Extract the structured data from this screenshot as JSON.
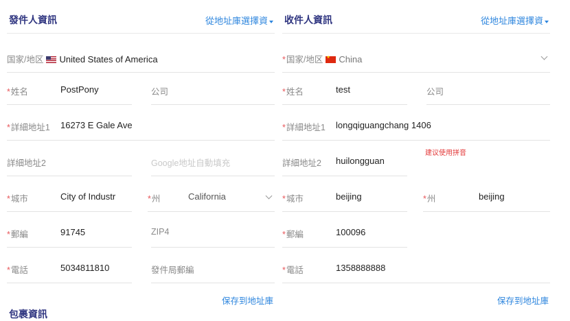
{
  "sender": {
    "title": "發件人資訊",
    "address_book_select": "從地址庫選擇資",
    "country": {
      "label": "国家/地区",
      "value": "United States of America"
    },
    "name": {
      "label": "姓名",
      "value": "PostPony"
    },
    "company": {
      "placeholder": "公司"
    },
    "address1": {
      "label": "詳細地址1",
      "value": "16273 E Gale Ave"
    },
    "address2": {
      "label": "詳細地址2"
    },
    "google_autofill": {
      "placeholder": "Google地址自動填充"
    },
    "city": {
      "label": "城市",
      "value": "City of Industr"
    },
    "state": {
      "label": "州",
      "value": "California"
    },
    "zip": {
      "label": "郵編",
      "value": "91745"
    },
    "zip4": {
      "placeholder": "ZIP4"
    },
    "phone": {
      "label": "電話",
      "value": "5034811810"
    },
    "post_office_zip": {
      "placeholder": "發件局郵編"
    },
    "save_link": "保存到地址庫"
  },
  "receiver": {
    "title": "收件人資訊",
    "address_book_select": "從地址庫選擇資",
    "country": {
      "label": "国家/地区",
      "value": "China"
    },
    "name": {
      "label": "姓名",
      "value": "test"
    },
    "company": {
      "placeholder": "公司"
    },
    "address1": {
      "label": "詳細地址1",
      "value": "longqiguangchang 1406"
    },
    "pinyin_hint": "建议使用拼音",
    "address2": {
      "label": "詳細地址2",
      "value": "huilongguan"
    },
    "city": {
      "label": "城市",
      "value": "beijing"
    },
    "state": {
      "label": "州",
      "value": "beijing"
    },
    "zip": {
      "label": "郵編",
      "value": "100096"
    },
    "phone": {
      "label": "電話",
      "value": "1358888888"
    },
    "save_link": "保存到地址庫"
  },
  "package": {
    "title": "包裹資訊"
  },
  "required_mark": "*",
  "icons": {
    "us_flag": "us-flag-icon",
    "cn_flag": "china-flag-icon",
    "caret": "caret-down-icon",
    "chevron": "chevron-down-icon"
  },
  "colors": {
    "title": "#2f3580",
    "link": "#2e86de",
    "required": "#e8585b",
    "hint": "#e33a3a"
  }
}
